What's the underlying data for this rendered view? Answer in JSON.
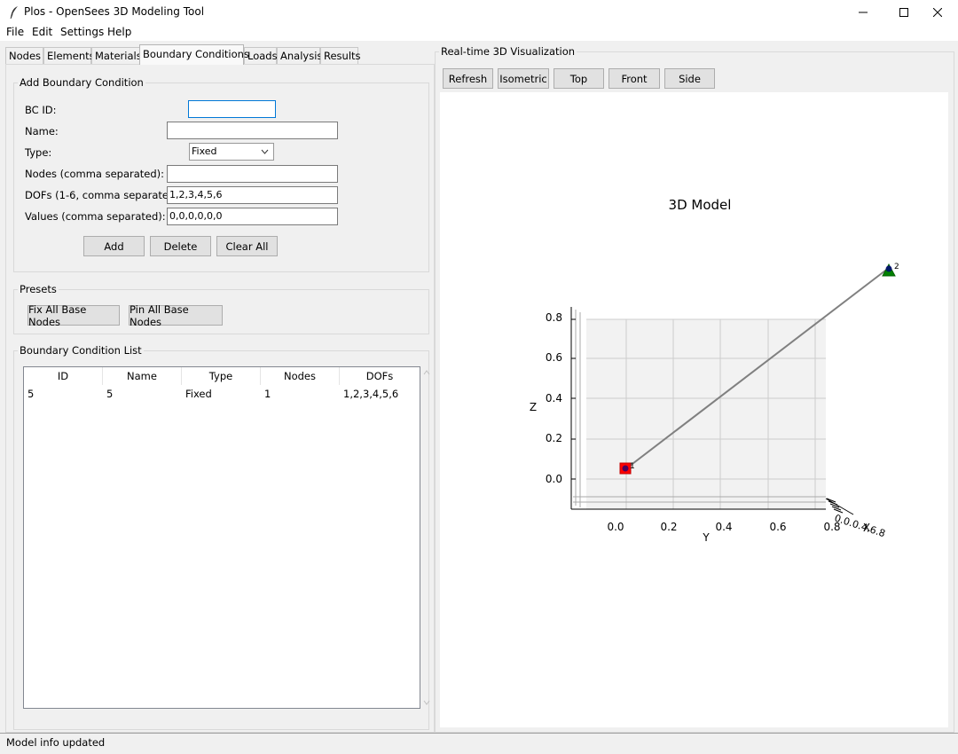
{
  "window": {
    "title": "Plos - OpenSees 3D Modeling Tool",
    "minimize_icon": "minimize-icon",
    "maximize_icon": "maximize-icon",
    "close_icon": "close-icon"
  },
  "menu": [
    "File",
    "Edit",
    "Settings",
    "Help"
  ],
  "tabs": [
    "Nodes",
    "Elements",
    "Materials",
    "Boundary Conditions",
    "Loads",
    "Analysis",
    "Results"
  ],
  "active_tab": "Boundary Conditions",
  "add_bc": {
    "title": "Add Boundary Condition",
    "bc_id_label": "BC ID:",
    "bc_id_value": "",
    "name_label": "Name:",
    "name_value": "",
    "type_label": "Type:",
    "type_value": "Fixed",
    "nodes_label": "Nodes (comma separated):",
    "nodes_value": "",
    "dofs_label": "DOFs (1-6, comma separated):",
    "dofs_value": "1,2,3,4,5,6",
    "values_label": "Values (comma separated):",
    "values_value": "0,0,0,0,0,0",
    "add_button": "Add",
    "delete_button": "Delete",
    "clear_button": "Clear All"
  },
  "presets": {
    "title": "Presets",
    "fix_button": "Fix All Base Nodes",
    "pin_button": "Pin All Base Nodes"
  },
  "bc_list": {
    "title": "Boundary Condition List",
    "columns": [
      "ID",
      "Name",
      "Type",
      "Nodes",
      "DOFs"
    ],
    "rows": [
      [
        "5",
        "5",
        "Fixed",
        "1",
        "1,2,3,4,5,6"
      ]
    ]
  },
  "viz": {
    "title": "Real-time 3D Visualization",
    "buttons": [
      "Refresh",
      "Isometric",
      "Top",
      "Front",
      "Side"
    ],
    "plot_title": "3D Model",
    "z_label": "Z",
    "y_label": "Y",
    "x_label": "X",
    "z_ticks": [
      "0.8",
      "0.6",
      "0.4",
      "0.2",
      "0.0"
    ],
    "y_ticks": [
      "0.0",
      "0.2",
      "0.4",
      "0.6",
      "0.8"
    ],
    "x_ticks_overlap": "0.0.0.4.6.8",
    "node_labels": [
      "1",
      "2"
    ],
    "colors": {
      "pane": "#f2f2f2",
      "grid": "#cccccc",
      "element_line": "#808080",
      "fixed_support": "#ff0000",
      "pinned_support": "#008000",
      "node": "#000080"
    }
  },
  "status": {
    "text": "Model info updated"
  }
}
